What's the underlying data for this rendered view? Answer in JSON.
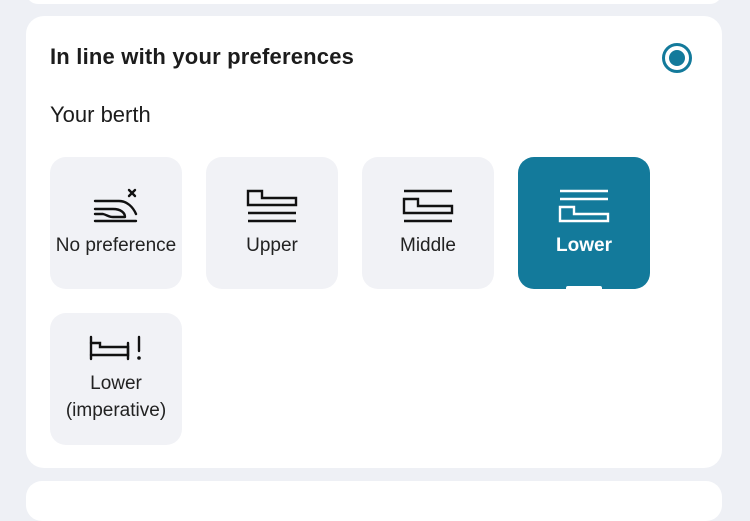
{
  "card": {
    "title": "In line with your preferences",
    "radio_selected": true,
    "section_label": "Your berth"
  },
  "berth_options": [
    {
      "label": "No preference",
      "icon": "no-preference-berth-icon",
      "selected": false
    },
    {
      "label": "Upper",
      "icon": "upper-berth-icon",
      "selected": false
    },
    {
      "label": "Middle",
      "icon": "middle-berth-icon",
      "selected": false
    },
    {
      "label": "Lower",
      "icon": "lower-berth-icon",
      "selected": true
    },
    {
      "label": "Lower\n(imperative)",
      "icon": "lower-imperative-berth-icon",
      "selected": false
    }
  ],
  "colors": {
    "accent": "#137a9b",
    "tile_background": "#f1f2f6",
    "page_background": "#eef0f5"
  }
}
